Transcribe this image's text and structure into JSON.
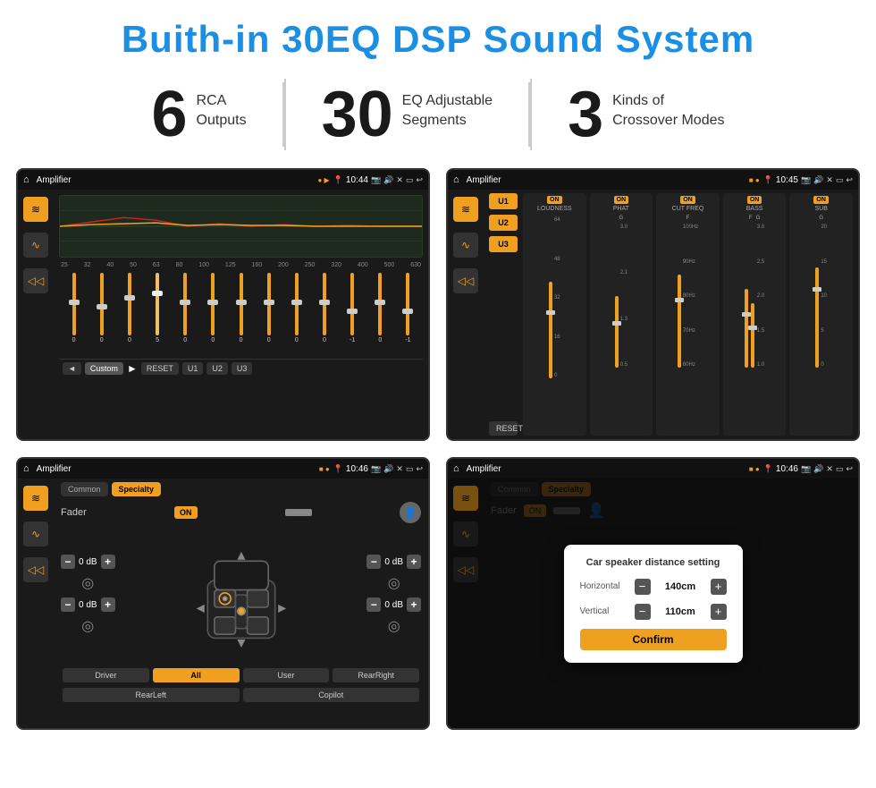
{
  "page": {
    "title": "Buith-in 30EQ DSP Sound System",
    "stats": [
      {
        "number": "6",
        "line1": "RCA",
        "line2": "Outputs"
      },
      {
        "number": "30",
        "line1": "EQ Adjustable",
        "line2": "Segments"
      },
      {
        "number": "3",
        "line1": "Kinds of",
        "line2": "Crossover Modes"
      }
    ]
  },
  "screens": {
    "eq": {
      "topbar": {
        "title": "Amplifier",
        "time": "10:44"
      },
      "freqs": [
        "25",
        "32",
        "40",
        "50",
        "63",
        "80",
        "100",
        "125",
        "160",
        "200",
        "250",
        "320",
        "400",
        "500",
        "630"
      ],
      "values": [
        "0",
        "0",
        "0",
        "5",
        "0",
        "0",
        "0",
        "0",
        "0",
        "0",
        "-1",
        "0",
        "-1"
      ],
      "buttons": [
        "Custom",
        "RESET",
        "U1",
        "U2",
        "U3"
      ]
    },
    "crossover": {
      "topbar": {
        "title": "Amplifier",
        "time": "10:45"
      },
      "presets": [
        "U1",
        "U2",
        "U3"
      ],
      "channels": [
        {
          "name": "LOUDNESS",
          "on": true
        },
        {
          "name": "PHAT",
          "on": true
        },
        {
          "name": "CUT FREQ",
          "on": true
        },
        {
          "name": "BASS",
          "on": true
        },
        {
          "name": "SUB",
          "on": true
        }
      ],
      "reset_label": "RESET"
    },
    "fader": {
      "topbar": {
        "title": "Amplifier",
        "time": "10:46"
      },
      "tabs": [
        "Common",
        "Specialty"
      ],
      "active_tab": "Specialty",
      "fader_label": "Fader",
      "on_label": "ON",
      "levels": [
        {
          "label": "0 dB",
          "pos": "front-left"
        },
        {
          "label": "0 dB",
          "pos": "front-right"
        },
        {
          "label": "0 dB",
          "pos": "rear-left"
        },
        {
          "label": "0 dB",
          "pos": "rear-right"
        }
      ],
      "bottom_buttons": [
        "Driver",
        "All",
        "User",
        "RearRight",
        "RearLeft",
        "Copilot"
      ]
    },
    "distance": {
      "topbar": {
        "title": "Amplifier",
        "time": "10:46"
      },
      "dialog": {
        "title": "Car speaker distance setting",
        "horizontal_label": "Horizontal",
        "horizontal_value": "140cm",
        "vertical_label": "Vertical",
        "vertical_value": "110cm",
        "confirm_label": "Confirm"
      }
    }
  },
  "icons": {
    "home": "⌂",
    "back": "↩",
    "location": "📍",
    "camera": "📷",
    "speaker": "🔊",
    "close": "✕",
    "window": "▭",
    "eq_icon": "≋",
    "wave_icon": "∿",
    "speaker_icon": "◁"
  }
}
